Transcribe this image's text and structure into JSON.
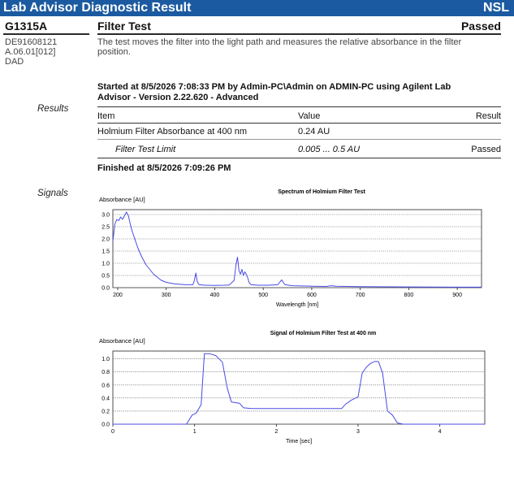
{
  "banner": {
    "title": "Lab Advisor Diagnostic Result",
    "right": "NSL"
  },
  "module": {
    "id": "G1315A",
    "serial": "DE91608121",
    "firmware": "A.06.01[012]",
    "type": "DAD"
  },
  "test": {
    "name": "Filter Test",
    "status": "Passed",
    "description_line1": "The test moves the filter into the light path and measures the relative absorbance in the filter",
    "description_line2": "position."
  },
  "run": {
    "started_line1": "Started at 8/5/2026 7:08:33 PM by Admin-PC\\Admin on ADMIN-PC using Agilent Lab",
    "started_line2": "Advisor - Version 2.22.620 - Advanced",
    "finished": "Finished at 8/5/2026 7:09:26 PM"
  },
  "results": {
    "section_label": "Results",
    "headers": {
      "item": "Item",
      "value": "Value",
      "result": "Result"
    },
    "rows": [
      {
        "item": "Holmium Filter Absorbance at 400 nm",
        "value": "0.24 AU",
        "result": ""
      },
      {
        "item": "Filter Test Limit",
        "value": "0.005 ... 0.5 AU",
        "result": "Passed"
      }
    ]
  },
  "signals_label": "Signals",
  "colors": {
    "banner": "#1b5aa0",
    "line": "#4a4ae6"
  },
  "chart_data": [
    {
      "type": "line",
      "title": "Spectrum of Holmium Filter Test",
      "ylabel": "Absorbance [AU]",
      "xlabel": "Wavelength [nm]",
      "xlim": [
        190,
        950
      ],
      "ylim": [
        0,
        3.2
      ],
      "xticks": [
        200,
        300,
        400,
        500,
        600,
        700,
        800,
        900
      ],
      "yticks": [
        0.0,
        0.5,
        1.0,
        1.5,
        2.0,
        2.5,
        3.0
      ],
      "ytick_labels": [
        "0.0",
        "0.5",
        "1.0",
        "1.5",
        "2.0",
        "2.5",
        "3.0"
      ],
      "grid": true,
      "series": [
        {
          "x": [
            190,
            194,
            198,
            202,
            206,
            210,
            214,
            218,
            222,
            226,
            230,
            236,
            242,
            250,
            258,
            266,
            274,
            282,
            290,
            300,
            310,
            320,
            340,
            355,
            358,
            361,
            364,
            368,
            380,
            400,
            420,
            430,
            440,
            444,
            447,
            450,
            453,
            456,
            459,
            462,
            465,
            468,
            471,
            475,
            490,
            510,
            530,
            535,
            538,
            541,
            545,
            560,
            600,
            630,
            640,
            650,
            700,
            800,
            900,
            950
          ],
          "y": [
            1.9,
            2.6,
            2.8,
            2.75,
            2.9,
            2.8,
            2.95,
            3.1,
            2.95,
            2.6,
            2.3,
            1.95,
            1.6,
            1.25,
            0.95,
            0.75,
            0.55,
            0.42,
            0.3,
            0.22,
            0.18,
            0.15,
            0.12,
            0.12,
            0.3,
            0.6,
            0.25,
            0.12,
            0.1,
            0.09,
            0.1,
            0.11,
            0.3,
            0.95,
            1.25,
            0.7,
            0.55,
            0.75,
            0.5,
            0.65,
            0.55,
            0.4,
            0.2,
            0.12,
            0.1,
            0.1,
            0.12,
            0.25,
            0.32,
            0.22,
            0.12,
            0.08,
            0.06,
            0.05,
            0.08,
            0.06,
            0.04,
            0.03,
            0.02,
            0.02
          ]
        }
      ]
    },
    {
      "type": "line",
      "title": "Signal of Holmium Filter Test at 400 nm",
      "ylabel": "Absorbance [AU]",
      "xlabel": "Time [sec]",
      "xlim": [
        0,
        4.55
      ],
      "ylim": [
        0,
        1.12
      ],
      "xticks": [
        0,
        1,
        2,
        3,
        4
      ],
      "yticks": [
        0.0,
        0.2,
        0.4,
        0.6,
        0.8,
        1.0
      ],
      "ytick_labels": [
        "0.0",
        "0.2",
        "0.4",
        "0.6",
        "0.8",
        "1.0"
      ],
      "grid": true,
      "series": [
        {
          "x": [
            0,
            0.9,
            0.97,
            1.02,
            1.08,
            1.12,
            1.18,
            1.26,
            1.34,
            1.4,
            1.45,
            1.55,
            1.6,
            1.7,
            2.0,
            2.5,
            2.8,
            2.85,
            2.92,
            3.0,
            3.05,
            3.1,
            3.15,
            3.2,
            3.25,
            3.3,
            3.36,
            3.42,
            3.48,
            3.55,
            4.55
          ],
          "y": [
            0,
            0,
            0.14,
            0.17,
            0.3,
            1.08,
            1.08,
            1.05,
            0.95,
            0.55,
            0.34,
            0.32,
            0.25,
            0.24,
            0.24,
            0.24,
            0.24,
            0.31,
            0.37,
            0.42,
            0.78,
            0.87,
            0.93,
            0.96,
            0.96,
            0.78,
            0.2,
            0.14,
            0.02,
            0,
            0
          ]
        }
      ]
    }
  ]
}
